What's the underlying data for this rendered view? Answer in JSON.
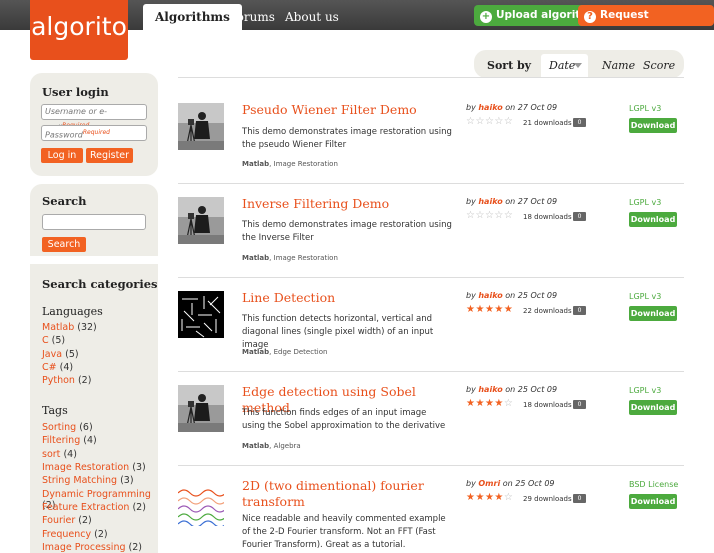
{
  "header": {
    "logo": "algorito",
    "nav": [
      "Algorithms",
      "Forums",
      "About us"
    ],
    "upload_label": "Upload algorithm",
    "request_label": "Request algorithm"
  },
  "login": {
    "title": "User login",
    "username_placeholder": "Username or e-mail",
    "password_placeholder": "Password",
    "required": "Required",
    "login_label": "Log in",
    "register_label": "Register"
  },
  "search": {
    "title": "Search",
    "button": "Search"
  },
  "categories": {
    "title": "Search categories",
    "languages_title": "Languages",
    "languages": [
      {
        "name": "Matlab",
        "count": "(32)"
      },
      {
        "name": "C",
        "count": "(5)"
      },
      {
        "name": "Java",
        "count": "(5)"
      },
      {
        "name": "C#",
        "count": "(4)"
      },
      {
        "name": "Python",
        "count": "(2)"
      }
    ],
    "tags_title": "Tags",
    "tags": [
      {
        "name": "Sorting",
        "count": "(6)"
      },
      {
        "name": "Filtering",
        "count": "(4)"
      },
      {
        "name": "sort",
        "count": "(4)"
      },
      {
        "name": "Image Restoration",
        "count": "(3)"
      },
      {
        "name": "String Matching",
        "count": "(3)"
      },
      {
        "name": "Dynamic Programming",
        "count": "(2)"
      },
      {
        "name": "Feature Extraction",
        "count": "(2)"
      },
      {
        "name": "Fourier",
        "count": "(2)"
      },
      {
        "name": "Frequency",
        "count": "(2)"
      },
      {
        "name": "Image Processing",
        "count": "(2)"
      }
    ]
  },
  "sort": {
    "label": "Sort by",
    "date": "Date",
    "name": "Name",
    "score": "Score"
  },
  "items": [
    {
      "title": "Pseudo Wiener Filter Demo",
      "desc": "This demo demonstrates image restoration using the pseudo Wiener Filter",
      "lang": "Matlab",
      "tag": "Image Restoration",
      "by": "by",
      "author": "haiko",
      "date": "on 27 Oct 09",
      "rating": 0,
      "downloads": "21 downloads",
      "comments": "0",
      "license": "LGPL v3",
      "download_label": "Download",
      "thumb": "photo-icon"
    },
    {
      "title": "Inverse Filtering Demo",
      "desc": "This demo demonstrates image restoration using the Inverse Filter",
      "lang": "Matlab",
      "tag": "Image Restoration",
      "by": "by",
      "author": "haiko",
      "date": "on 27 Oct 09",
      "rating": 0,
      "downloads": "18 downloads",
      "comments": "0",
      "license": "LGPL v3",
      "download_label": "Download",
      "thumb": "photo-icon"
    },
    {
      "title": "Line Detection",
      "desc": "This function detects horizontal, vertical and diagonal lines (single pixel width) of an input image",
      "lang": "Matlab",
      "tag": "Edge Detection",
      "by": "by",
      "author": "haiko",
      "date": "on 25 Oct 09",
      "rating": 5,
      "downloads": "22 downloads",
      "comments": "0",
      "license": "LGPL v3",
      "download_label": "Download",
      "thumb": "lines-icon"
    },
    {
      "title": "Edge detection using Sobel method",
      "desc": "This function finds edges of an input image using the Sobel approximation to the derivative",
      "lang": "Matlab",
      "tag": "Algebra",
      "by": "by",
      "author": "haiko",
      "date": "on 25 Oct 09",
      "rating": 4,
      "downloads": "18 downloads",
      "comments": "0",
      "license": "LGPL v3",
      "download_label": "Download",
      "thumb": "photo-icon"
    },
    {
      "title": "2D (two dimentional) fourier transform",
      "desc": "Nice readable and heavily commented example of the 2-D Fourier transform. Not an FFT (Fast Fourier Transform). Great as a tutorial.",
      "by": "by",
      "author": "Omri",
      "date": "on 25 Oct 09",
      "rating": 4,
      "downloads": "29 downloads",
      "comments": "0",
      "license": "BSD License",
      "download_label": "Download",
      "thumb": "waves-icon"
    }
  ],
  "colors": {
    "brand": "#e8501c",
    "green": "#4caa3e",
    "orange": "#f26222"
  }
}
